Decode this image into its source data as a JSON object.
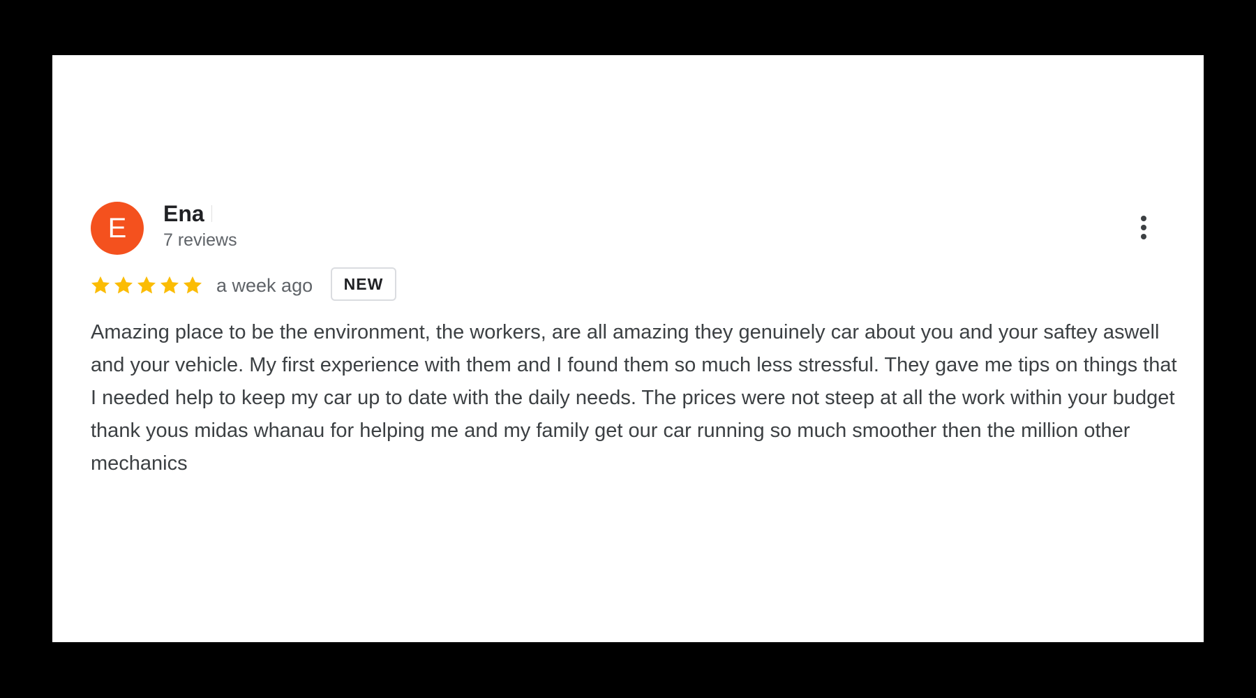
{
  "review": {
    "avatar_initial": "E",
    "avatar_color": "#f4511e",
    "reviewer_name": "Ena",
    "review_count": "7 reviews",
    "rating": 5,
    "rating_max": 5,
    "star_color": "#fbbc04",
    "time": "a week ago",
    "badge": "NEW",
    "text": "Amazing place to be the environment, the workers, are all amazing they genuinely car about you and your saftey aswell and your vehicle. My first experience with them and I found them so much less stressful. They gave me tips on things that I needed help to keep my car up to date with the daily needs. The prices were not steep at all the work within your budget thank yous midas whanau for helping me and my family get our car running so much smoother then the million other mechanics",
    "menu_icon": "more-vert-icon"
  }
}
